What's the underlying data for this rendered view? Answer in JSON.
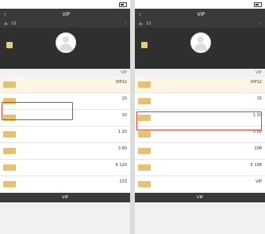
{
  "left": {
    "status": {
      "time": "",
      "carrier": ""
    },
    "nav": {
      "title": "VIP",
      "close": ""
    },
    "banner": {
      "text": "12"
    },
    "profile": {
      "name": "",
      "sub": "",
      "login": ""
    },
    "tabs": {
      "left": "",
      "right": "VIP"
    },
    "items": [
      {
        "btn": "",
        "t1": "VIP12",
        "t2": "",
        "tag": "",
        "promo": true
      },
      {
        "btn": "",
        "t1": "15",
        "t2": "",
        "tag": "",
        "promo": false
      },
      {
        "btn": "",
        "t1": "10",
        "t2": "",
        "tag": "",
        "promo": false
      },
      {
        "btn": "",
        "t1": "1 20",
        "t2": "",
        "tag": "",
        "promo": false
      },
      {
        "btn": "",
        "t1": "3 60",
        "t2": "",
        "tag": "",
        "promo": false
      },
      {
        "btn": "",
        "t1": "6 120",
        "t2": "",
        "tag": "",
        "promo": false
      },
      {
        "btn": "",
        "t1": "233",
        "t2": "",
        "tag": "",
        "promo": false
      }
    ],
    "footer": {
      "text": "VIP"
    }
  },
  "right": {
    "status": {
      "time": "",
      "carrier": ""
    },
    "nav": {
      "title": "VIP",
      "close": ""
    },
    "banner": {
      "text": "12"
    },
    "profile": {
      "name": "",
      "sub": "",
      "login": ""
    },
    "tabs": {
      "left": "",
      "right": "VIP"
    },
    "items": [
      {
        "btn": "",
        "t1": "VIP12",
        "t2": "",
        "tag": "",
        "promo": true
      },
      {
        "btn": "",
        "t1": "15",
        "t2": "",
        "tag": "",
        "promo": false
      },
      {
        "btn": "",
        "t1": "1 20",
        "t2": "",
        "tag": "",
        "promo": false
      },
      {
        "btn": "",
        "t1": "3 58",
        "t2": "",
        "tag": "",
        "promo": false
      },
      {
        "btn": "",
        "t1": "108",
        "t2": "",
        "tag": "",
        "promo": false
      },
      {
        "btn": "",
        "t1": "6 108",
        "t2": "",
        "tag": "",
        "promo": false
      },
      {
        "btn": "",
        "t1": "VIP",
        "t2": "",
        "tag": "",
        "promo": false
      }
    ],
    "footer": {
      "text": "VIP"
    }
  },
  "colors": {
    "highlight": "#e33b2a",
    "gold": "#e6c173",
    "dark": "#3a3a3a"
  }
}
